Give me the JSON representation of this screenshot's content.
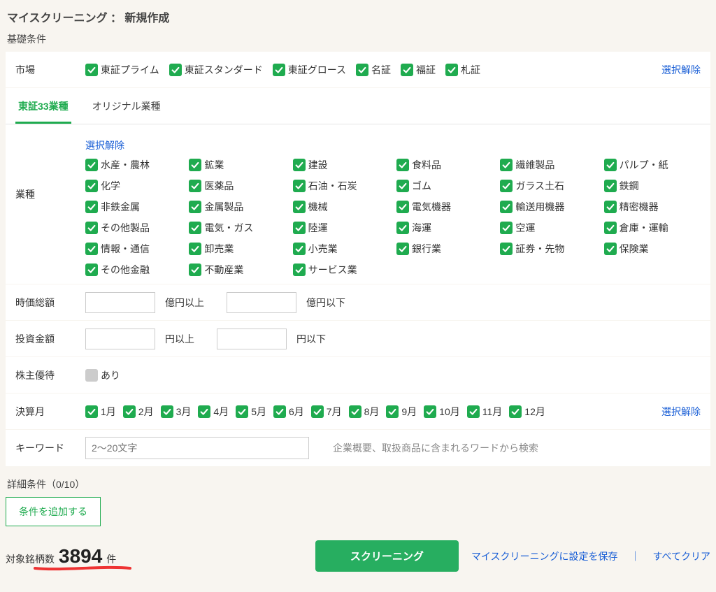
{
  "page_title": "マイスクリーニング ： 新規作成",
  "basic_title": "基礎条件",
  "rows": {
    "market": "市場",
    "industry": "業種",
    "marketcap": "時価総額",
    "invest": "投資金額",
    "yutai": "株主優待",
    "settle": "決算月",
    "keyword": "キーワード"
  },
  "deselect": "選択解除",
  "markets": [
    "東証プライム",
    "東証スタンダード",
    "東証グロース",
    "名証",
    "福証",
    "札証"
  ],
  "tabs": {
    "tse33": "東証33業種",
    "original": "オリジナル業種"
  },
  "industries": [
    "水産・農林",
    "鉱業",
    "建設",
    "食料品",
    "繊維製品",
    "パルプ・紙",
    "化学",
    "医薬品",
    "石油・石炭",
    "ゴム",
    "ガラス土石",
    "鉄鋼",
    "非鉄金属",
    "金属製品",
    "機械",
    "電気機器",
    "輸送用機器",
    "精密機器",
    "その他製品",
    "電気・ガス",
    "陸運",
    "海運",
    "空運",
    "倉庫・運輸",
    "情報・通信",
    "卸売業",
    "小売業",
    "銀行業",
    "証券・先物",
    "保険業",
    "その他金融",
    "不動産業",
    "サービス業"
  ],
  "cap": {
    "above": "億円以上",
    "below": "億円以下"
  },
  "invest_u": {
    "above": "円以上",
    "below": "円以下"
  },
  "yutai_label": "あり",
  "months": [
    "1月",
    "2月",
    "3月",
    "4月",
    "5月",
    "6月",
    "7月",
    "8月",
    "9月",
    "10月",
    "11月",
    "12月"
  ],
  "keyword_placeholder": "2〜20文字",
  "keyword_hint": "企業概要、取扱商品に含まれるワードから検索",
  "detail_title": "詳細条件（0/10）",
  "add_cond": "条件を追加する",
  "count": {
    "label": "対象銘柄数",
    "value": "3894",
    "unit": "件"
  },
  "footer": {
    "screen": "スクリーニング",
    "save": "マイスクリーニングに設定を保存",
    "clear": "すべてクリア"
  }
}
